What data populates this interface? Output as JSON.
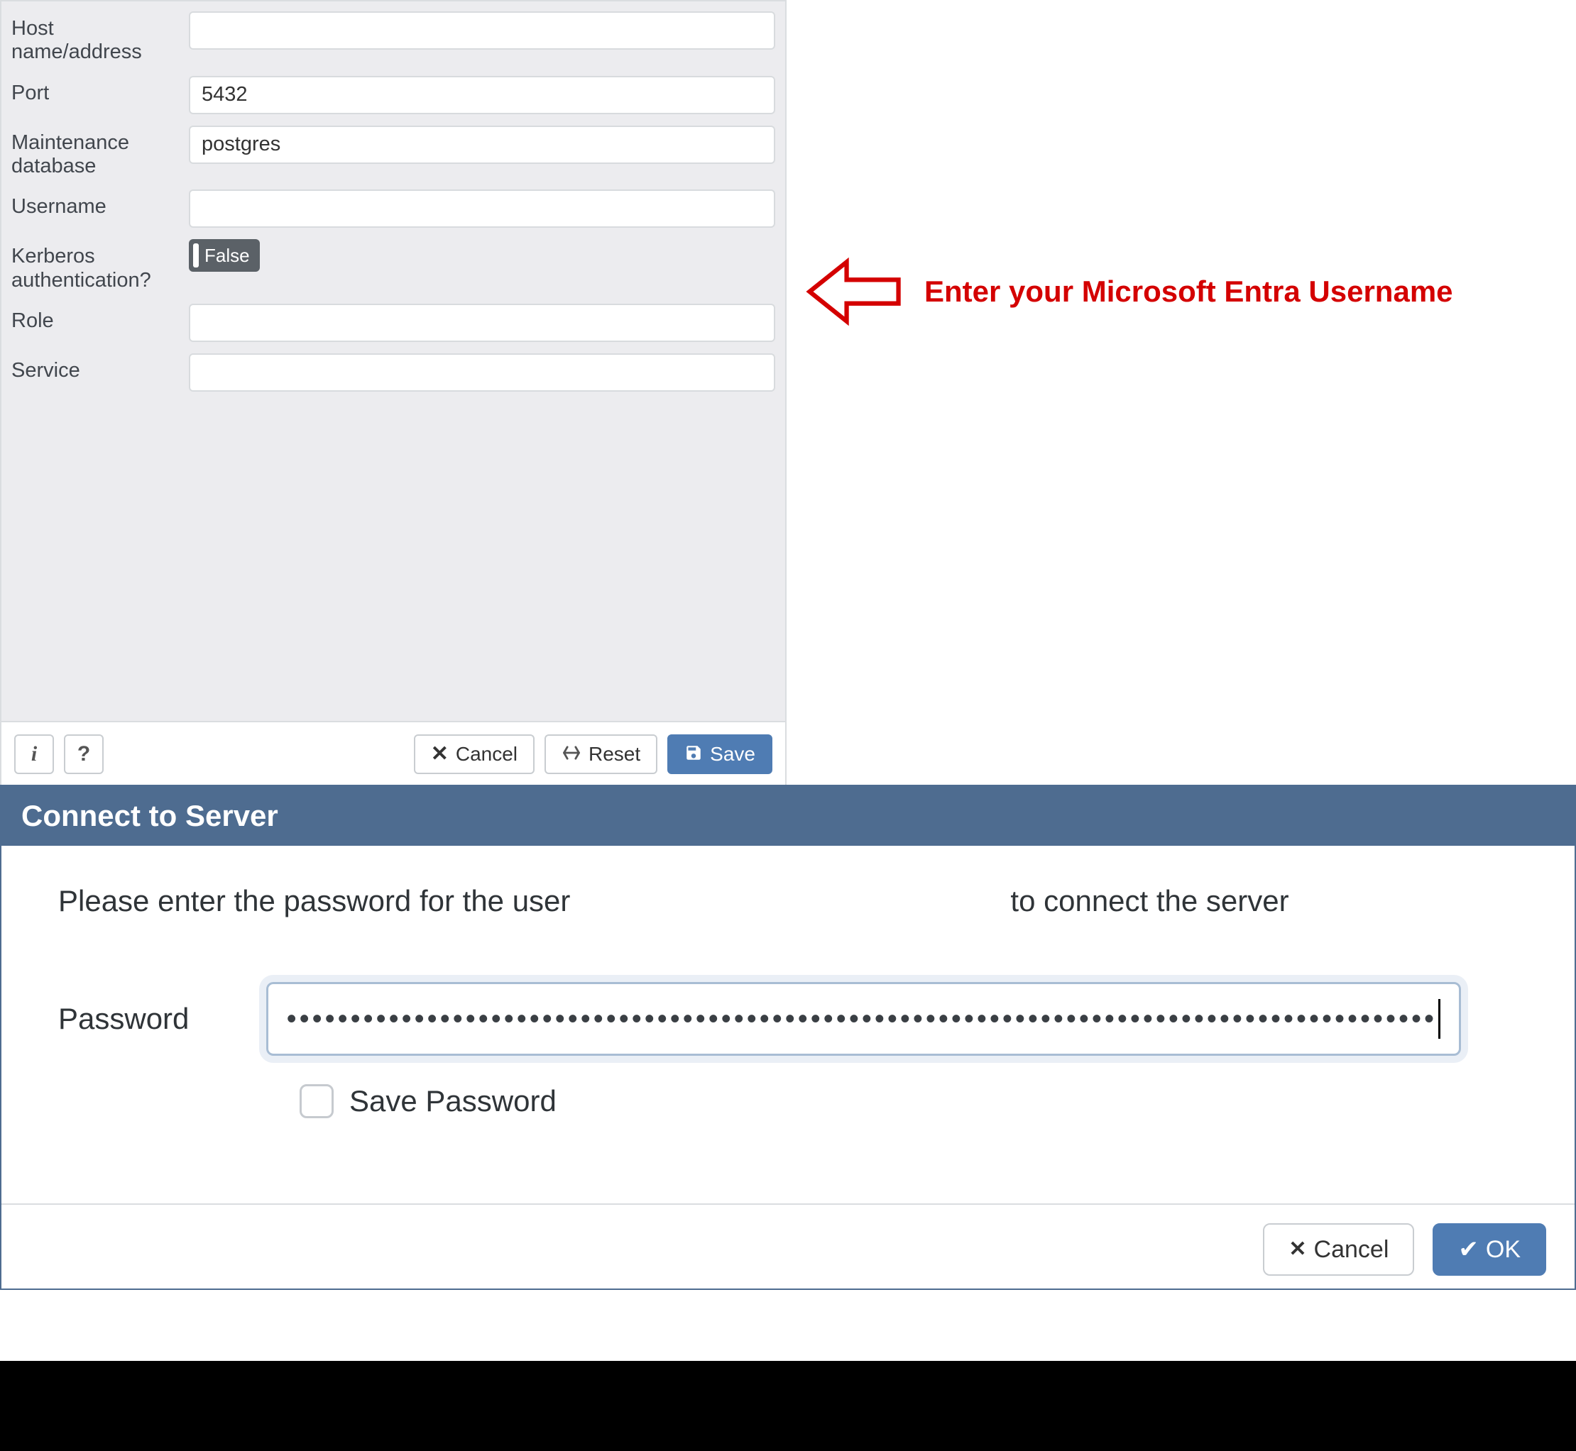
{
  "config": {
    "fields": {
      "host_label": "Host name/address",
      "host_value": "",
      "port_label": "Port",
      "port_value": "5432",
      "maintdb_label": "Maintenance database",
      "maintdb_value": "postgres",
      "username_label": "Username",
      "username_value": "",
      "kerberos_label": "Kerberos authentication?",
      "kerberos_value": "False",
      "role_label": "Role",
      "role_value": "",
      "service_label": "Service",
      "service_value": ""
    },
    "footer": {
      "info_label": "i",
      "help_label": "?",
      "cancel_label": "Cancel",
      "reset_label": "Reset",
      "save_label": "Save"
    }
  },
  "annotation": {
    "text": "Enter your Microsoft Entra Username"
  },
  "connect_dialog": {
    "title": "Connect to Server",
    "prompt_prefix": "Please enter the password for the user",
    "prompt_suffix": "to connect the server",
    "password_label": "Password",
    "password_mask": "••••••••••••••••••••••••••••••••••••••••••••••••••••••••••••••••••••••••••••••••••••••••••",
    "save_pw_label": "Save Password",
    "cancel_label": "Cancel",
    "ok_label": "OK"
  }
}
